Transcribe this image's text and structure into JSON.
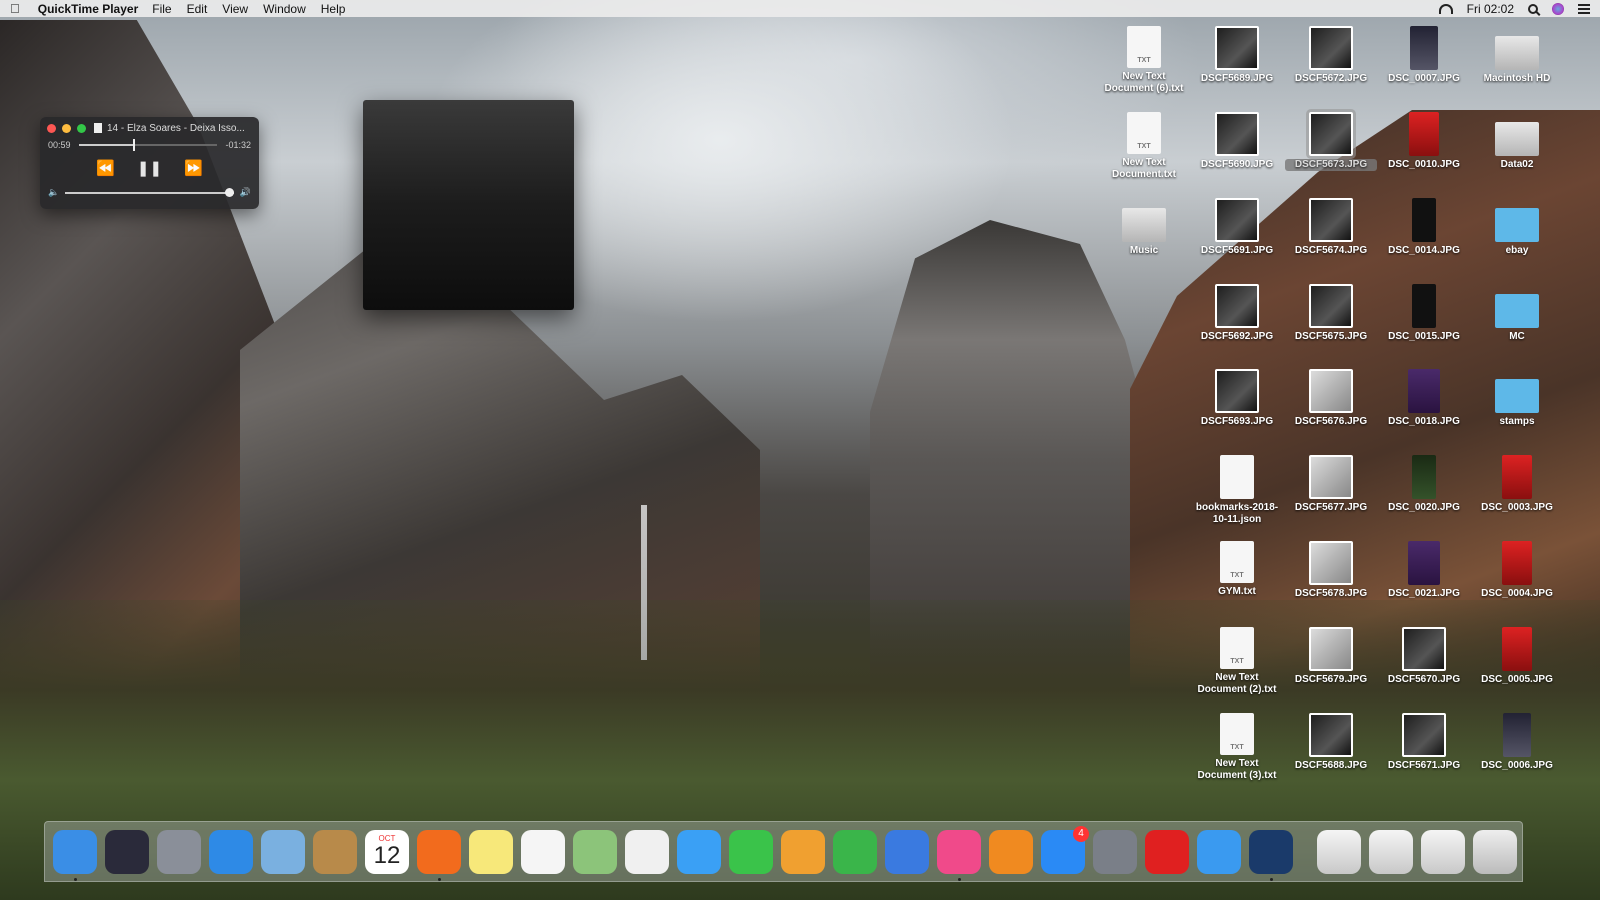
{
  "menubar": {
    "app_name": "QuickTime Player",
    "menus": [
      "File",
      "Edit",
      "View",
      "Window",
      "Help"
    ],
    "clock": "Fri 02:02"
  },
  "player": {
    "title": "14 - Elza Soares - Deixa Isso...",
    "elapsed": "00:59",
    "remaining": "-01:32",
    "progress": 0.39,
    "volume": 1.0
  },
  "desktop_icons": [
    {
      "label": "New Text Document (6).txt",
      "type": "txt"
    },
    {
      "label": "DSCF5689.JPG",
      "type": "photo-dark"
    },
    {
      "label": "DSCF5672.JPG",
      "type": "photo-dark"
    },
    {
      "label": "DSC_0007.JPG",
      "type": "navy"
    },
    {
      "label": "Macintosh HD",
      "type": "disk"
    },
    {
      "label": "New Text Document.txt",
      "type": "txt"
    },
    {
      "label": "DSCF5690.JPG",
      "type": "photo-dark"
    },
    {
      "label": "DSCF5673.JPG",
      "type": "photo-dark",
      "selected": true
    },
    {
      "label": "DSC_0010.JPG",
      "type": "red"
    },
    {
      "label": "Data02",
      "type": "disk"
    },
    {
      "label": "Music",
      "type": "disk"
    },
    {
      "label": "DSCF5691.JPG",
      "type": "photo-dark"
    },
    {
      "label": "DSCF5674.JPG",
      "type": "photo-dark"
    },
    {
      "label": "DSC_0014.JPG",
      "type": "black"
    },
    {
      "label": "ebay",
      "type": "folder"
    },
    {
      "label": "DSCF5692.JPG",
      "type": "photo-dark"
    },
    {
      "label": "DSCF5675.JPG",
      "type": "photo-dark"
    },
    {
      "label": "DSC_0015.JPG",
      "type": "black"
    },
    {
      "label": "MC",
      "type": "folder"
    },
    {
      "label": "DSCF5693.JPG",
      "type": "photo-dark"
    },
    {
      "label": "DSCF5676.JPG",
      "type": "photo-light"
    },
    {
      "label": "DSC_0018.JPG",
      "type": "purple"
    },
    {
      "label": "stamps",
      "type": "folder"
    },
    {
      "label": "bookmarks-2018-10-11.json",
      "type": "json"
    },
    {
      "label": "DSCF5677.JPG",
      "type": "photo-light"
    },
    {
      "label": "DSC_0020.JPG",
      "type": "green"
    },
    {
      "label": "DSC_0003.JPG",
      "type": "red"
    },
    {
      "label": "GYM.txt",
      "type": "txt"
    },
    {
      "label": "DSCF5678.JPG",
      "type": "photo-light"
    },
    {
      "label": "DSC_0021.JPG",
      "type": "purple"
    },
    {
      "label": "DSC_0004.JPG",
      "type": "red"
    },
    {
      "label": "New Text Document (2).txt",
      "type": "txt"
    },
    {
      "label": "DSCF5679.JPG",
      "type": "photo-light"
    },
    {
      "label": "DSCF5670.JPG",
      "type": "photo-dark"
    },
    {
      "label": "DSC_0005.JPG",
      "type": "red"
    },
    {
      "label": "New Text Document (3).txt",
      "type": "txt"
    },
    {
      "label": "DSCF5688.JPG",
      "type": "photo-dark"
    },
    {
      "label": "DSCF5671.JPG",
      "type": "photo-dark"
    },
    {
      "label": "DSC_0006.JPG",
      "type": "navy"
    }
  ],
  "dock": {
    "apps": [
      {
        "icon": "finder-icon",
        "color": "#3a8ee6",
        "running": true
      },
      {
        "icon": "siri-icon",
        "color": "#2a2a3a",
        "running": false
      },
      {
        "icon": "launchpad-icon",
        "color": "#8a8f99",
        "running": false
      },
      {
        "icon": "safari-icon",
        "color": "#2e8ae6",
        "running": false
      },
      {
        "icon": "mail-icon",
        "color": "#7ab0e0",
        "running": false
      },
      {
        "icon": "contacts-icon",
        "color": "#b88a4a",
        "running": false
      },
      {
        "icon": "calendar-icon",
        "color": "#ffffff",
        "running": false,
        "month": "OCT",
        "day": "12"
      },
      {
        "icon": "firefox-icon",
        "color": "#f26b1d",
        "running": true
      },
      {
        "icon": "notes-icon",
        "color": "#f7e87a",
        "running": false
      },
      {
        "icon": "reminders-icon",
        "color": "#f5f5f5",
        "running": false
      },
      {
        "icon": "maps-icon",
        "color": "#8cc47a",
        "running": false
      },
      {
        "icon": "photos-icon",
        "color": "#f0f0f0",
        "running": false
      },
      {
        "icon": "messages-icon",
        "color": "#3aa0f5",
        "running": false
      },
      {
        "icon": "facetime-icon",
        "color": "#3ac34a",
        "running": false
      },
      {
        "icon": "pages-icon",
        "color": "#f0a030",
        "running": false
      },
      {
        "icon": "numbers-icon",
        "color": "#3ab54a",
        "running": false
      },
      {
        "icon": "keynote-icon",
        "color": "#3a7ae0",
        "running": false
      },
      {
        "icon": "itunes-icon",
        "color": "#f04a8a",
        "running": true
      },
      {
        "icon": "books-icon",
        "color": "#f08a20",
        "running": false
      },
      {
        "icon": "app-store-icon",
        "color": "#2a8af5",
        "running": false,
        "badge": "4"
      },
      {
        "icon": "system-preferences-icon",
        "color": "#7a7f88",
        "running": false
      },
      {
        "icon": "roblox-icon",
        "color": "#e02020",
        "running": false
      },
      {
        "icon": "roblox-studio-icon",
        "color": "#3a9af0",
        "running": false
      },
      {
        "icon": "quicktime-icon",
        "color": "#1a3a6a",
        "running": true
      }
    ],
    "stacks": [
      {
        "icon": "downloads-stack-icon"
      },
      {
        "icon": "documents-stack-icon"
      },
      {
        "icon": "music-stack-icon"
      },
      {
        "icon": "trash-icon"
      }
    ]
  }
}
